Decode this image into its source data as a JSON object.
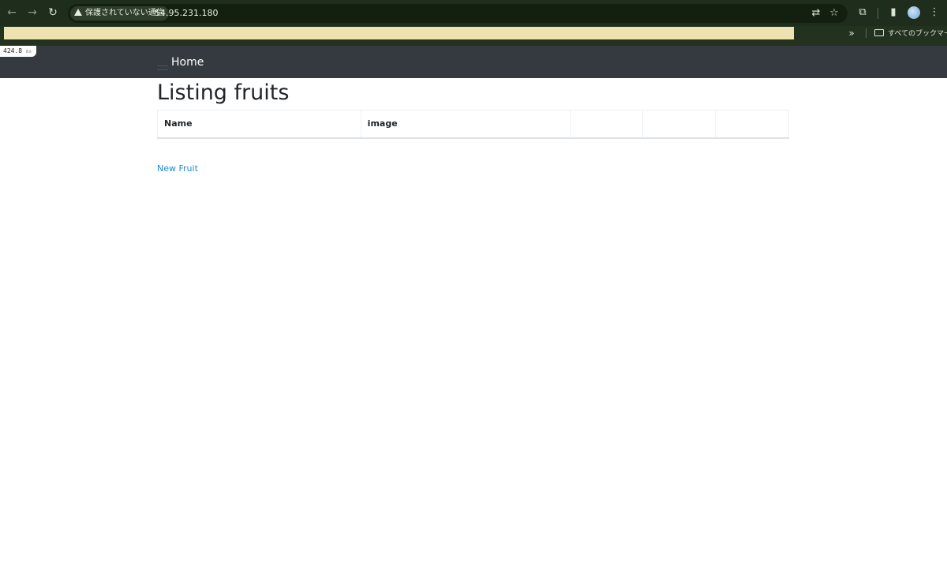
{
  "browser": {
    "security_label": "保護されていない通信",
    "url": "54.95.231.180",
    "bookmarks_folder_label": "すべてのブックマーク",
    "overflow_glyph": "»"
  },
  "timing": {
    "value": "424.8",
    "unit": "ms"
  },
  "site_nav": {
    "home_label": "Home"
  },
  "page": {
    "title": "Listing fruits",
    "table": {
      "columns": [
        "Name",
        "image",
        "",
        "",
        ""
      ]
    },
    "new_link_label": "New Fruit"
  },
  "colors": {
    "navbar_bg": "#343a40",
    "link": "#1d8ad8",
    "heading_text": "#212529"
  }
}
